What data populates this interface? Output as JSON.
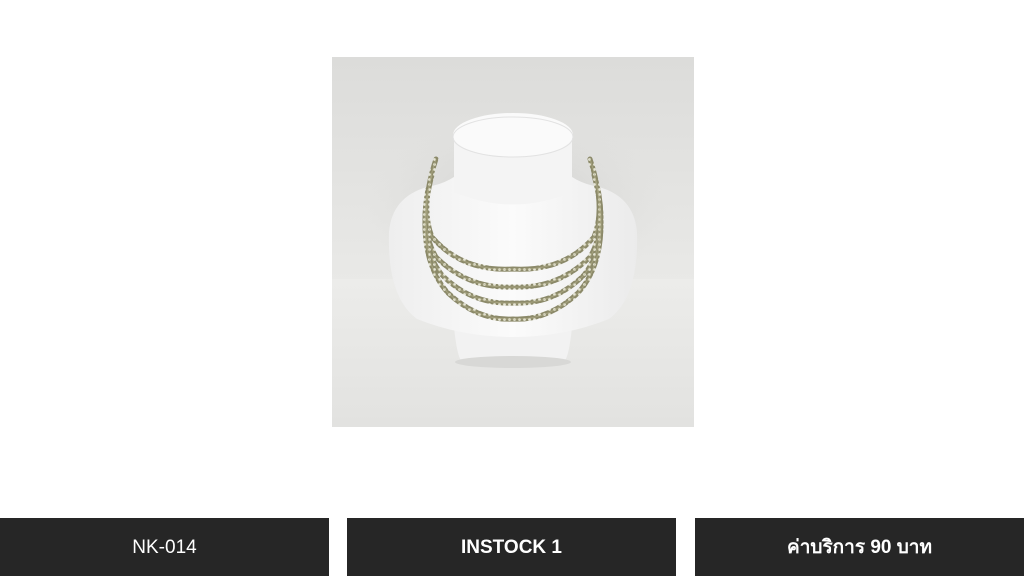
{
  "product": {
    "code": "NK-014",
    "stock": "INSTOCK 1",
    "price": "ค่าบริการ 90 บาท"
  },
  "colors": {
    "background": "#ffffff",
    "info_bar": "#262626",
    "info_text": "#ffffff"
  }
}
